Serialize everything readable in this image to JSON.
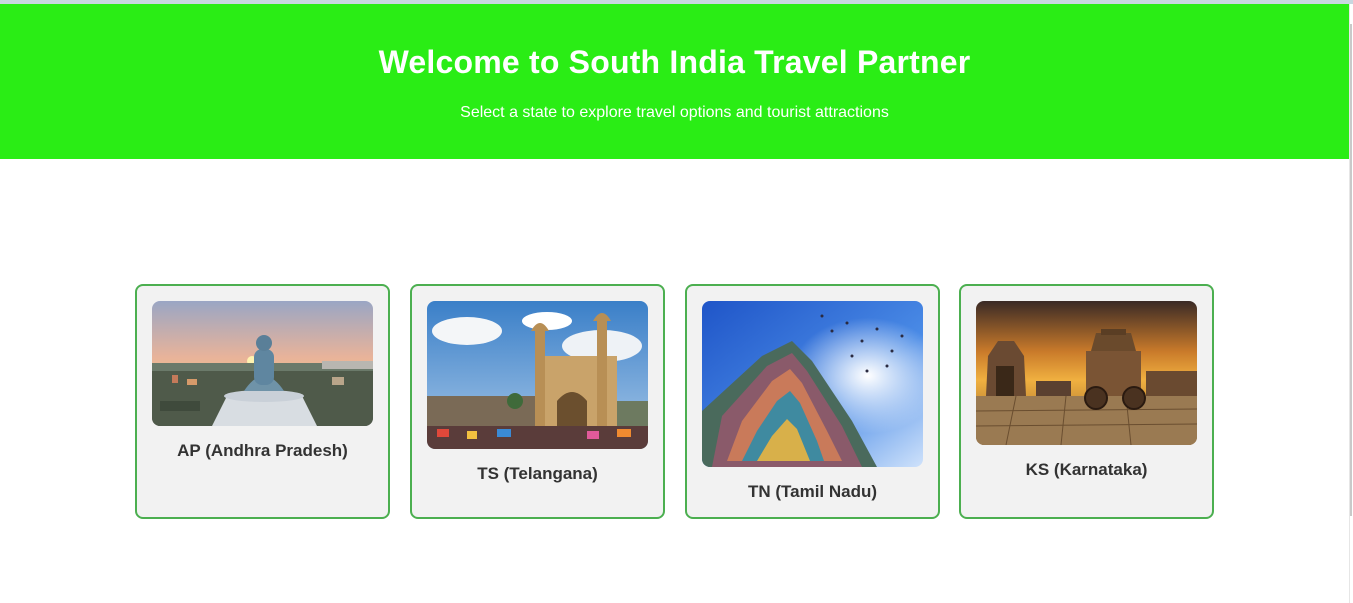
{
  "header": {
    "title": "Welcome to South India Travel Partner",
    "subtitle": "Select a state to explore travel options and tourist attractions"
  },
  "states": [
    {
      "label": "AP (Andhra Pradesh)",
      "image": "buddha-statue-sunset"
    },
    {
      "label": "TS (Telangana)",
      "image": "charminar"
    },
    {
      "label": "TN (Tamil Nadu)",
      "image": "temple-gopuram"
    },
    {
      "label": "KS (Karnataka)",
      "image": "hampi-stone-chariot"
    }
  ],
  "colors": {
    "banner": "#2aed15",
    "card_border": "#4caf50",
    "card_bg": "#f2f2f2"
  }
}
